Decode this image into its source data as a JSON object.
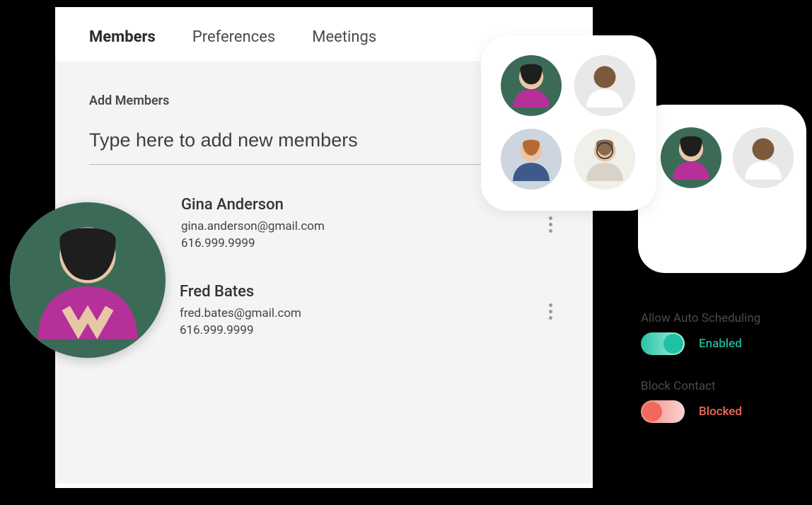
{
  "tabs": {
    "members": "Members",
    "preferences": "Preferences",
    "meetings": "Meetings"
  },
  "add_members": {
    "label": "Add Members",
    "placeholder": "Type here to add new members"
  },
  "members": [
    {
      "name": "Gina Anderson",
      "email": "gina.anderson@gmail.com",
      "phone": "616.999.9999",
      "avatar_icon": "avatar-gina"
    },
    {
      "name": "Fred Bates",
      "email": "fred.bates@gmail.com",
      "phone": "616.999.9999",
      "avatar_icon": "avatar-fred"
    }
  ],
  "avatar_cards": {
    "front": [
      "avatar-gina",
      "avatar-fred",
      "avatar-person3",
      "avatar-person4"
    ],
    "back": [
      "avatar-gina",
      "avatar-fred"
    ]
  },
  "settings": {
    "auto_schedule": {
      "label": "Allow Auto Scheduling",
      "state": "Enabled",
      "on": true
    },
    "block_contact": {
      "label": "Block Contact",
      "state": "Blocked",
      "on": false
    }
  },
  "colors": {
    "accent_green": "#1cb896",
    "accent_red": "#ef6a5d"
  }
}
